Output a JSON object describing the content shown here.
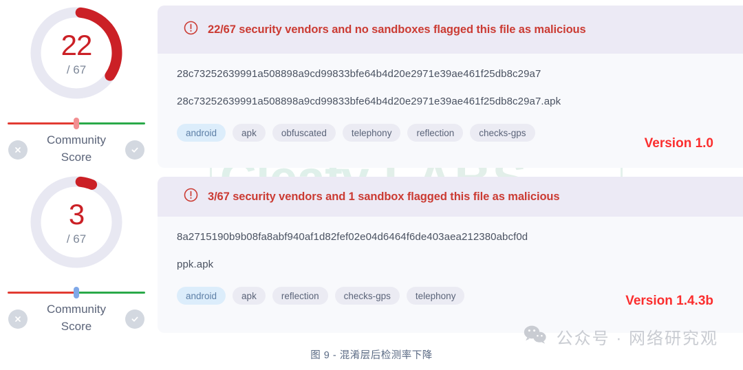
{
  "watermark": {
    "brand": ".Cleafy",
    "labs": "LABS"
  },
  "scores": [
    {
      "detections": "22",
      "total": "/ 67",
      "ratio": 0.328,
      "label": "Community\nScore",
      "label_line1": "Community",
      "label_line2": "Score",
      "thumb_color": "#f28f92",
      "arc_color": "#cb2026",
      "reject_icon": "close-icon",
      "accept_icon": "check-icon"
    },
    {
      "detections": "3",
      "total": "/ 67",
      "ratio": 0.045,
      "label_line1": "Community",
      "label_line2": "Score",
      "thumb_color": "#7fa8e8",
      "arc_color": "#cb2026",
      "reject_icon": "close-icon",
      "accept_icon": "check-icon"
    }
  ],
  "cards": [
    {
      "alert_icon": "exclamation-circle-icon",
      "alert_text": "22/67 security vendors and no sandboxes flagged this file as malicious",
      "hash": "28c73252639991a508898a9cd99833bfe64b4d20e2971e39ae461f25db8c29a7",
      "filename": "28c73252639991a508898a9cd99833bfe64b4d20e2971e39ae461f25db8c29a7.apk",
      "tags": [
        "android",
        "apk",
        "obfuscated",
        "telephony",
        "reflection",
        "checks-gps"
      ],
      "version": "Version 1.0"
    },
    {
      "alert_icon": "exclamation-circle-icon",
      "alert_text": "3/67 security vendors and 1 sandbox flagged this file as malicious",
      "hash": "8a2715190b9b08fa8abf940af1d82fef02e04d6464f6de403aea212380abcf0d",
      "filename": "ppk.apk",
      "tags": [
        "android",
        "apk",
        "reflection",
        "checks-gps",
        "telephony"
      ],
      "version": "Version 1.4.3b"
    }
  ],
  "footer": {
    "caption": "图 9 - 混淆层后检测率下降",
    "wechat_icon": "wechat-icon",
    "wechat_text": "公众号 · 网络研究观"
  },
  "colors": {
    "alert_red": "#cb3b33",
    "version_red": "#fb2e2e",
    "banner_bg": "#eceaf5",
    "card_bg": "#f8f9fc",
    "tag_bg": "#ebebf3",
    "tag_highlight_bg": "#dcedfb",
    "slider_red": "#e23b32",
    "slider_green": "#2aa949",
    "gauge_track": "#e8e8f2"
  }
}
